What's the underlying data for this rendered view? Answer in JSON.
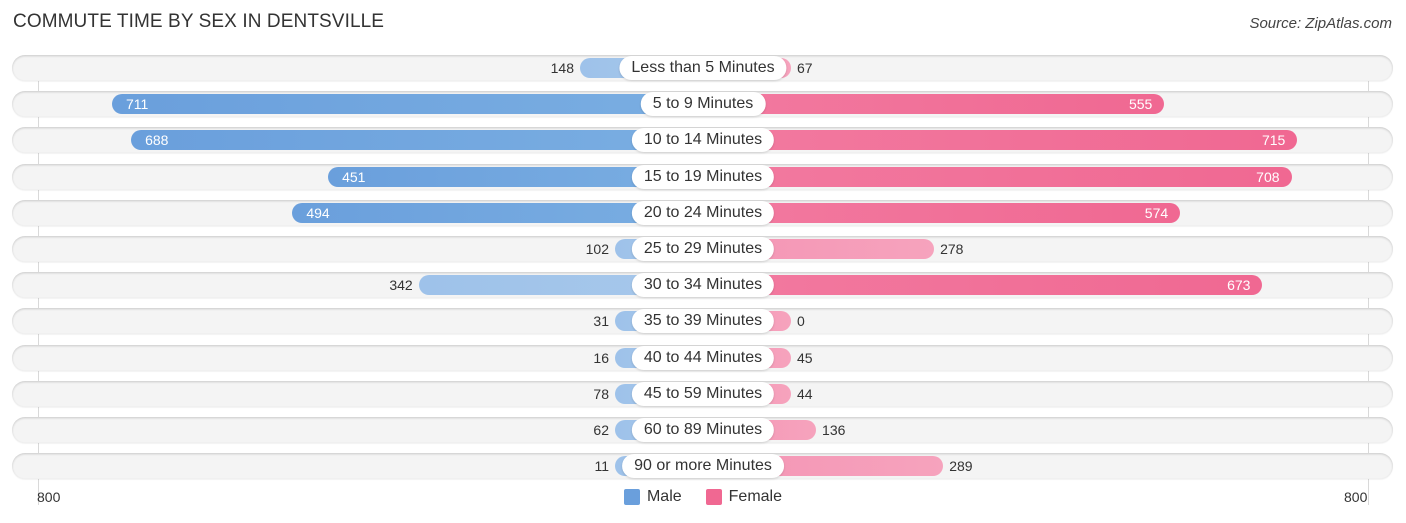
{
  "chart_data": {
    "type": "bar",
    "orientation": "horizontal-diverging",
    "title": "COMMUTE TIME BY SEX IN DENTSVILLE",
    "source": "Source: ZipAtlas.com",
    "categories": [
      "Less than 5 Minutes",
      "5 to 9 Minutes",
      "10 to 14 Minutes",
      "15 to 19 Minutes",
      "20 to 24 Minutes",
      "25 to 29 Minutes",
      "30 to 34 Minutes",
      "35 to 39 Minutes",
      "40 to 44 Minutes",
      "45 to 59 Minutes",
      "60 to 89 Minutes",
      "90 or more Minutes"
    ],
    "series": [
      {
        "name": "Male",
        "color": "#6a9fdc",
        "light_color": "#a7c8eb",
        "values": [
          148,
          711,
          688,
          451,
          494,
          102,
          342,
          31,
          16,
          78,
          62,
          11
        ]
      },
      {
        "name": "Female",
        "color": "#f06892",
        "light_color": "#f6a3bd",
        "values": [
          67,
          555,
          715,
          708,
          574,
          278,
          673,
          0,
          45,
          44,
          136,
          289
        ]
      }
    ],
    "axis": {
      "left_label": "800",
      "right_label": "800",
      "max": 800
    },
    "legend": {
      "position": "bottom-center",
      "items": [
        "Male",
        "Female"
      ]
    },
    "grid": false
  }
}
